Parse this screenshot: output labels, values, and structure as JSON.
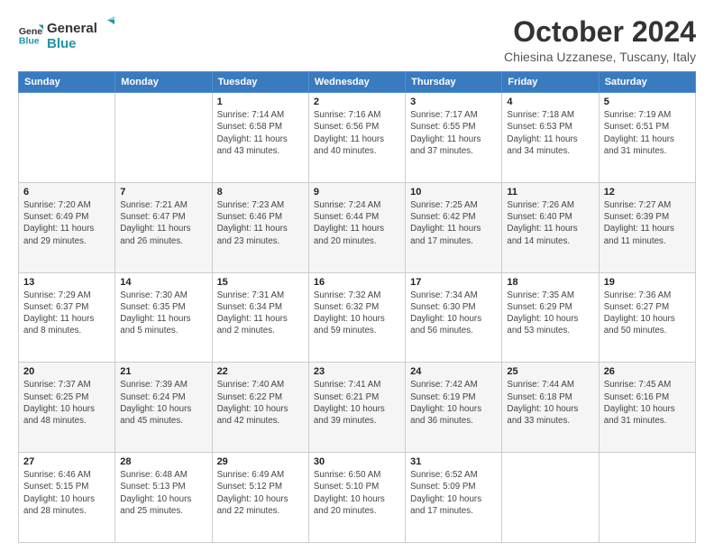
{
  "header": {
    "logo_line1": "General",
    "logo_line2": "Blue",
    "title": "October 2024",
    "subtitle": "Chiesina Uzzanese, Tuscany, Italy"
  },
  "days_of_week": [
    "Sunday",
    "Monday",
    "Tuesday",
    "Wednesday",
    "Thursday",
    "Friday",
    "Saturday"
  ],
  "weeks": [
    [
      {
        "num": "",
        "detail": ""
      },
      {
        "num": "",
        "detail": ""
      },
      {
        "num": "1",
        "detail": "Sunrise: 7:14 AM\nSunset: 6:58 PM\nDaylight: 11 hours and 43 minutes."
      },
      {
        "num": "2",
        "detail": "Sunrise: 7:16 AM\nSunset: 6:56 PM\nDaylight: 11 hours and 40 minutes."
      },
      {
        "num": "3",
        "detail": "Sunrise: 7:17 AM\nSunset: 6:55 PM\nDaylight: 11 hours and 37 minutes."
      },
      {
        "num": "4",
        "detail": "Sunrise: 7:18 AM\nSunset: 6:53 PM\nDaylight: 11 hours and 34 minutes."
      },
      {
        "num": "5",
        "detail": "Sunrise: 7:19 AM\nSunset: 6:51 PM\nDaylight: 11 hours and 31 minutes."
      }
    ],
    [
      {
        "num": "6",
        "detail": "Sunrise: 7:20 AM\nSunset: 6:49 PM\nDaylight: 11 hours and 29 minutes."
      },
      {
        "num": "7",
        "detail": "Sunrise: 7:21 AM\nSunset: 6:47 PM\nDaylight: 11 hours and 26 minutes."
      },
      {
        "num": "8",
        "detail": "Sunrise: 7:23 AM\nSunset: 6:46 PM\nDaylight: 11 hours and 23 minutes."
      },
      {
        "num": "9",
        "detail": "Sunrise: 7:24 AM\nSunset: 6:44 PM\nDaylight: 11 hours and 20 minutes."
      },
      {
        "num": "10",
        "detail": "Sunrise: 7:25 AM\nSunset: 6:42 PM\nDaylight: 11 hours and 17 minutes."
      },
      {
        "num": "11",
        "detail": "Sunrise: 7:26 AM\nSunset: 6:40 PM\nDaylight: 11 hours and 14 minutes."
      },
      {
        "num": "12",
        "detail": "Sunrise: 7:27 AM\nSunset: 6:39 PM\nDaylight: 11 hours and 11 minutes."
      }
    ],
    [
      {
        "num": "13",
        "detail": "Sunrise: 7:29 AM\nSunset: 6:37 PM\nDaylight: 11 hours and 8 minutes."
      },
      {
        "num": "14",
        "detail": "Sunrise: 7:30 AM\nSunset: 6:35 PM\nDaylight: 11 hours and 5 minutes."
      },
      {
        "num": "15",
        "detail": "Sunrise: 7:31 AM\nSunset: 6:34 PM\nDaylight: 11 hours and 2 minutes."
      },
      {
        "num": "16",
        "detail": "Sunrise: 7:32 AM\nSunset: 6:32 PM\nDaylight: 10 hours and 59 minutes."
      },
      {
        "num": "17",
        "detail": "Sunrise: 7:34 AM\nSunset: 6:30 PM\nDaylight: 10 hours and 56 minutes."
      },
      {
        "num": "18",
        "detail": "Sunrise: 7:35 AM\nSunset: 6:29 PM\nDaylight: 10 hours and 53 minutes."
      },
      {
        "num": "19",
        "detail": "Sunrise: 7:36 AM\nSunset: 6:27 PM\nDaylight: 10 hours and 50 minutes."
      }
    ],
    [
      {
        "num": "20",
        "detail": "Sunrise: 7:37 AM\nSunset: 6:25 PM\nDaylight: 10 hours and 48 minutes."
      },
      {
        "num": "21",
        "detail": "Sunrise: 7:39 AM\nSunset: 6:24 PM\nDaylight: 10 hours and 45 minutes."
      },
      {
        "num": "22",
        "detail": "Sunrise: 7:40 AM\nSunset: 6:22 PM\nDaylight: 10 hours and 42 minutes."
      },
      {
        "num": "23",
        "detail": "Sunrise: 7:41 AM\nSunset: 6:21 PM\nDaylight: 10 hours and 39 minutes."
      },
      {
        "num": "24",
        "detail": "Sunrise: 7:42 AM\nSunset: 6:19 PM\nDaylight: 10 hours and 36 minutes."
      },
      {
        "num": "25",
        "detail": "Sunrise: 7:44 AM\nSunset: 6:18 PM\nDaylight: 10 hours and 33 minutes."
      },
      {
        "num": "26",
        "detail": "Sunrise: 7:45 AM\nSunset: 6:16 PM\nDaylight: 10 hours and 31 minutes."
      }
    ],
    [
      {
        "num": "27",
        "detail": "Sunrise: 6:46 AM\nSunset: 5:15 PM\nDaylight: 10 hours and 28 minutes."
      },
      {
        "num": "28",
        "detail": "Sunrise: 6:48 AM\nSunset: 5:13 PM\nDaylight: 10 hours and 25 minutes."
      },
      {
        "num": "29",
        "detail": "Sunrise: 6:49 AM\nSunset: 5:12 PM\nDaylight: 10 hours and 22 minutes."
      },
      {
        "num": "30",
        "detail": "Sunrise: 6:50 AM\nSunset: 5:10 PM\nDaylight: 10 hours and 20 minutes."
      },
      {
        "num": "31",
        "detail": "Sunrise: 6:52 AM\nSunset: 5:09 PM\nDaylight: 10 hours and 17 minutes."
      },
      {
        "num": "",
        "detail": ""
      },
      {
        "num": "",
        "detail": ""
      }
    ]
  ]
}
